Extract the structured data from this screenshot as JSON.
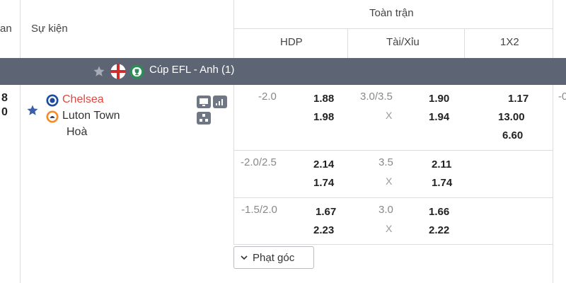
{
  "header": {
    "col_time_partial": "an",
    "col_event": "Sự kiện",
    "group_full_match": "Toàn trận",
    "col_hdp": "HDP",
    "col_ou": "Tài/Xỉu",
    "col_1x2": "1X2"
  },
  "league": {
    "name": "Cúp EFL - Anh (1)",
    "favorite_icon": "star-icon",
    "flag_icon": "england-flag-icon",
    "competition_icon": "efl-cup-icon"
  },
  "match": {
    "time_partial_top": "8",
    "time_partial_bottom": "0",
    "home_team": "Chelsea",
    "away_team": "Luton Town",
    "draw_label": "Hoà",
    "home_color": "#e0473f",
    "favorite_color": "#3b5ea8"
  },
  "odds": [
    {
      "hdp_line": "-2.0",
      "hdp_home": "1.88",
      "hdp_away": "1.98",
      "ou_line": "3.0/3.5",
      "ou_over": "1.90",
      "ou_x": "X",
      "ou_under": "1.94",
      "x12_home": "1.17",
      "x12_away": "13.00",
      "x12_draw": "6.60",
      "next_col_partial": "-0"
    },
    {
      "hdp_line": "-2.0/2.5",
      "hdp_home": "2.14",
      "hdp_away": "1.74",
      "ou_line": "3.5",
      "ou_over": "2.11",
      "ou_x": "X",
      "ou_under": "1.74"
    },
    {
      "hdp_line": "-1.5/2.0",
      "hdp_home": "1.67",
      "hdp_away": "2.23",
      "ou_line": "3.0",
      "ou_over": "1.66",
      "ou_x": "X",
      "ou_under": "2.22"
    }
  ],
  "corner_button": {
    "label": "Phạt góc",
    "icon": "chevron-down-icon"
  }
}
